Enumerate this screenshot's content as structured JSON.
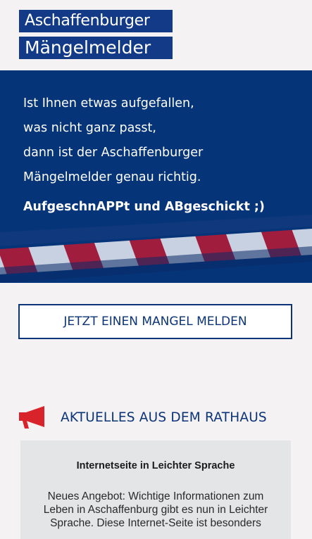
{
  "logo": {
    "line1": "Aschaffenburger",
    "line2": "Mängelmelder"
  },
  "hero": {
    "lines": [
      "Ist Ihnen etwas aufgefallen,",
      "was nicht ganz passt,",
      "dann ist der Aschaffenburger",
      "Mängelmelder genau richtig."
    ],
    "slogan": "AufgeschnAPPt und ABgeschickt ;)"
  },
  "cta": {
    "label": "JETZT EINEN MANGEL MELDEN"
  },
  "news": {
    "icon": "megaphone-icon",
    "title": "AKTUELLES AUS DEM RATHAUS",
    "card": {
      "title": "Internetseite in Leichter Sprache",
      "body": "Neues Angebot: Wichtige Informationen zum Leben in Aschaffenburg gibt es nun in Leichter Sprache. Diese Internet-Seite ist besonders"
    }
  },
  "colors": {
    "brand_blue": "#063478",
    "accent_red": "#d8232a",
    "background": "#f4f2f2",
    "card_bg": "#e4e5e7"
  }
}
